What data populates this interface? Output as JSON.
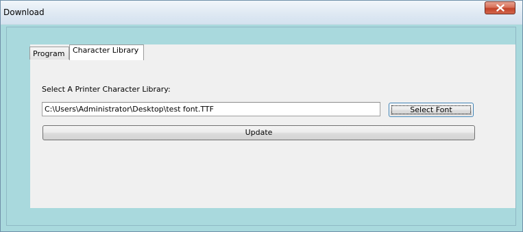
{
  "window": {
    "title": "Download"
  },
  "tabs": [
    {
      "label": "Program",
      "selected": false
    },
    {
      "label": "Character Library",
      "selected": true
    }
  ],
  "character_library": {
    "select_label": "Select A Printer Character Library:",
    "path_value": "C:\\Users\\Administrator\\Desktop\\test font.TTF",
    "select_font_label": "Select Font",
    "update_label": "Update"
  },
  "icons": {
    "close": "close-icon"
  },
  "colors": {
    "client_background": "#a9d9dd",
    "panel_background": "#f0f0f0",
    "close_button": "#c2432a"
  }
}
